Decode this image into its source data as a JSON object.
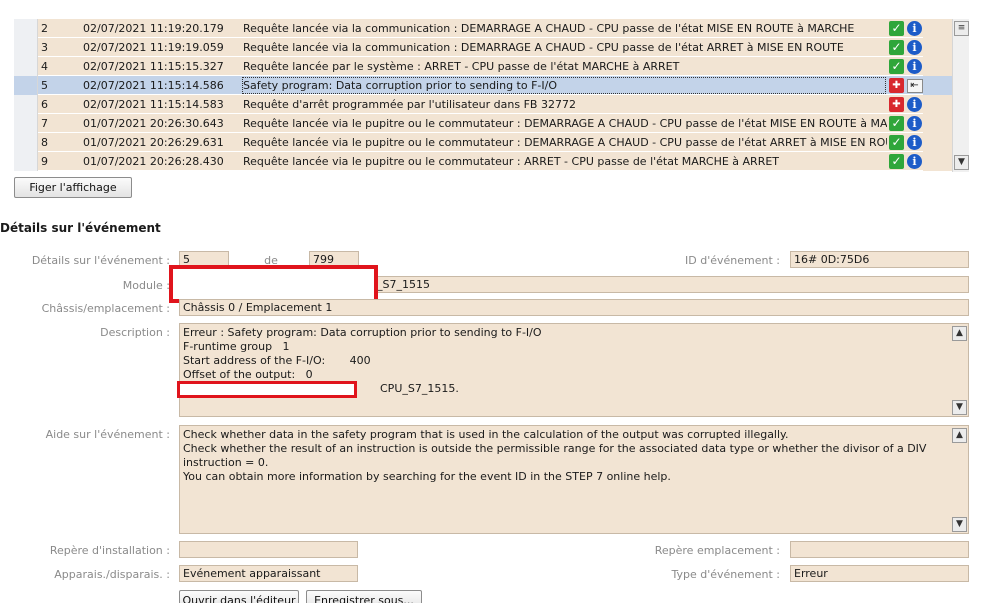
{
  "events": [
    {
      "num": "2",
      "date": "02/07/2021 11:19:20.179",
      "message": "Requête lancée via la communication : DEMARRAGE A CHAUD  - CPU passe de l'état MISE EN ROUTE à MARCHE",
      "status_icon": "check-icon",
      "selected": false
    },
    {
      "num": "3",
      "date": "02/07/2021 11:19:19.059",
      "message": "Requête lancée via la communication : DEMARRAGE A CHAUD  - CPU passe de l'état ARRET à MISE EN ROUTE",
      "status_icon": "check-icon",
      "selected": false
    },
    {
      "num": "4",
      "date": "02/07/2021 11:15:15.327",
      "message": "Requête lancée par le système : ARRET - CPU passe de l'état MARCHE à ARRET",
      "status_icon": "check-icon",
      "selected": false
    },
    {
      "num": "5",
      "date": "02/07/2021 11:15:14.586",
      "message": "Safety program: Data corruption prior to sending to F-I/O",
      "status_icon": "fault-icon",
      "selected": true
    },
    {
      "num": "6",
      "date": "02/07/2021 11:15:14.583",
      "message": "Requête d'arrêt programmée par l'utilisateur dans FB 32772",
      "status_icon": "fault-icon",
      "selected": false
    },
    {
      "num": "7",
      "date": "01/07/2021 20:26:30.643",
      "message": "Requête lancée via le pupitre ou le commutateur : DEMARRAGE A CHAUD  - CPU passe de l'état MISE EN ROUTE à MAR...",
      "status_icon": "check-icon",
      "selected": false
    },
    {
      "num": "8",
      "date": "01/07/2021 20:26:29.631",
      "message": "Requête lancée via le pupitre ou le commutateur : DEMARRAGE A CHAUD  - CPU passe de l'état ARRET à MISE EN ROUTE",
      "status_icon": "check-icon",
      "selected": false
    },
    {
      "num": "9",
      "date": "01/07/2021 20:26:28.430",
      "message": "Requête lancée via le pupitre ou le commutateur : ARRET - CPU passe de l'état MARCHE à ARRET",
      "status_icon": "check-icon",
      "selected": false
    }
  ],
  "freeze_button": "Figer l'affichage",
  "details": {
    "title": "Détails sur l'événement",
    "event_detail_label": "Détails sur l'événement :",
    "event_detail_value": "5",
    "of_label": "de",
    "of_value": "799",
    "event_id_label": "ID d'événement :",
    "event_id_value": "16# 0D:75D6",
    "module_label": "Module :",
    "module_value": "_S7_1515",
    "rack_label": "Châssis/emplacement :",
    "rack_value": "Châssis 0 / Emplacement 1",
    "description_label": "Description :",
    "description_lines": [
      "Erreur : Safety program: Data corruption prior to sending to F-I/O",
      "F-runtime group   1",
      "Start address of the F-I/O:       400",
      "Offset of the output:   0",
      "CPU_S7_1515."
    ],
    "help_label": "Aide sur l'événement :",
    "help_lines": [
      "Check whether data in the safety program that is used in the calculation of the output was corrupted illegally.",
      "Check whether the result of an instruction is outside the permissible range for the associated data type or whether the divisor of a DIV",
      "instruction = 0.",
      "You can obtain more information by searching for the event ID in the STEP 7 online help."
    ],
    "plant_tag_label": "Repère d'installation :",
    "plant_tag_value": "",
    "location_tag_label": "Repère emplacement :",
    "location_tag_value": "",
    "appear_label": "Apparais./disparais. :",
    "appear_value": "Evénement apparaissant",
    "event_type_label": "Type d'événement :",
    "event_type_value": "Erreur",
    "open_editor_button": "Ouvrir dans l'éditeur",
    "save_as_button": "Enregistrer sous..."
  }
}
